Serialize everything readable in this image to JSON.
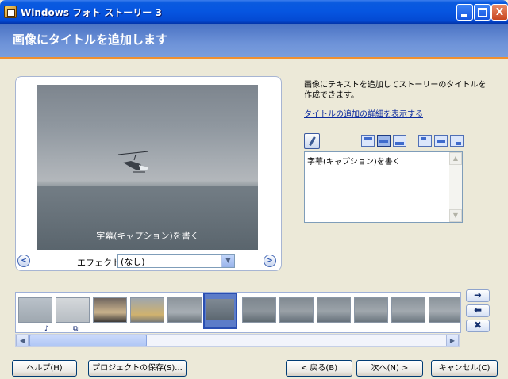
{
  "window": {
    "title": "Windows フォト ストーリー 3",
    "min_glyph": "_",
    "close_glyph": "X"
  },
  "header": {
    "title": "画像にタイトルを追加します"
  },
  "preview": {
    "caption_overlay": "字幕(キャプション)を書く",
    "prev_glyph": "<",
    "next_glyph": ">",
    "effect_label": "エフェクト(E):",
    "effect_value": "(なし)"
  },
  "panel": {
    "description": "画像にテキストを追加してストーリーのタイトルを作成できます。",
    "help_link": "タイトルの追加の詳細を表示する",
    "caption_text": "字幕(キャプション)を書く"
  },
  "filmstrip": {
    "selected_index": 5,
    "thumb_icons": [
      "♪",
      "⧉"
    ],
    "controls": [
      "➜",
      "⬅",
      "✖"
    ]
  },
  "buttons": {
    "help": "ヘルプ(H)",
    "save_project": "プロジェクトの保存(S)...",
    "back": "< 戻る(B)",
    "next": "次へ(N) >",
    "cancel": "キャンセル(C)"
  },
  "colors": {
    "titlebar": "#0655e0",
    "header": "#5c82cf",
    "accent_line": "#f09030",
    "selected_thumb": "#2a4fb2"
  }
}
